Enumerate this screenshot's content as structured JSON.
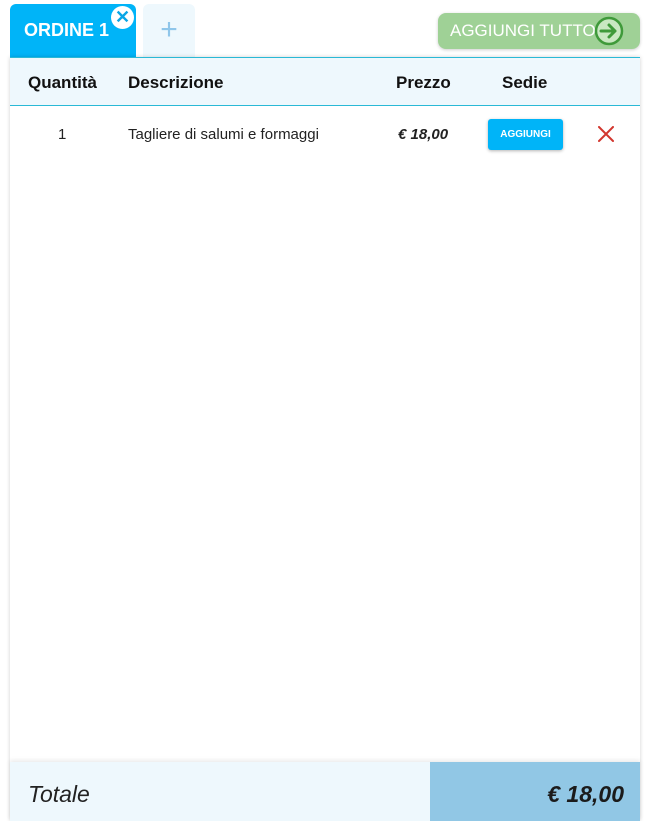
{
  "tabs": {
    "active_label": "ORDINE 1",
    "close_glyph": "✕",
    "add_glyph": "+"
  },
  "actions": {
    "add_all_label": "AGGIUNGI TUTTO",
    "add_all_icon": "arrow-right-circle-icon"
  },
  "table": {
    "headers": {
      "quantity": "Quantità",
      "description": "Descrizione",
      "price": "Prezzo",
      "seats": "Sedie"
    },
    "rows": [
      {
        "quantity": "1",
        "description": "Tagliere di salumi e formaggi",
        "price": "€ 18,00",
        "seat_button": "AGGIUNGI",
        "delete_icon": "close-icon"
      }
    ]
  },
  "footer": {
    "total_label": "Totale",
    "total_value": "€ 18,00"
  },
  "colors": {
    "primary": "#00b4f8",
    "add_all": "#9fd196",
    "add_all_icon": "#3f9a3a",
    "delete": "#d2362e",
    "header_bg": "#eef8fd",
    "total_bg": "#91c7e5"
  }
}
